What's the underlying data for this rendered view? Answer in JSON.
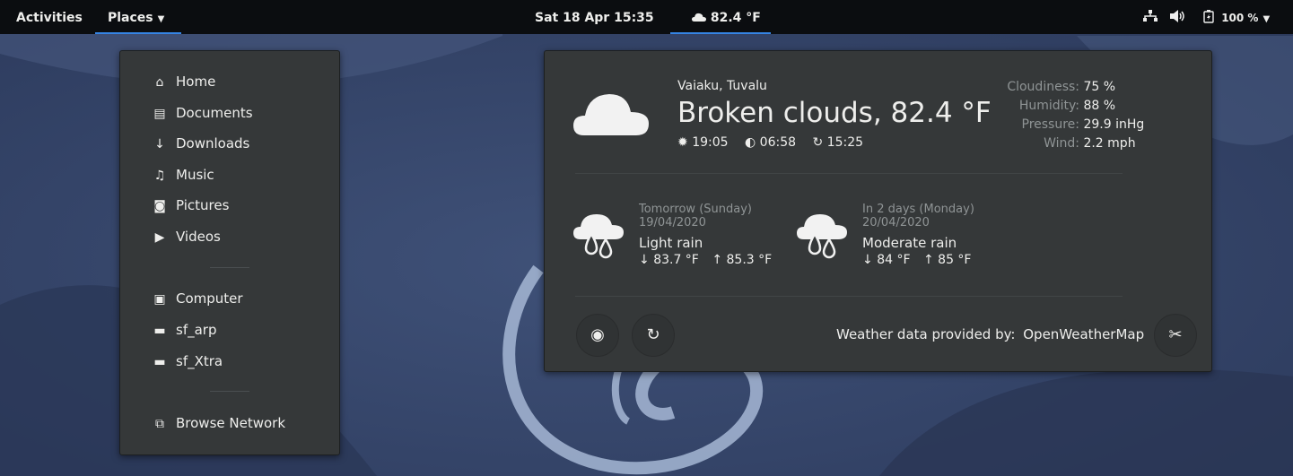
{
  "topbar": {
    "activities_label": "Activities",
    "places_label": "Places",
    "datetime": "Sat 18 Apr 15:35",
    "weather_indicator": "82.4 °F",
    "battery_label": "100 %"
  },
  "places": {
    "items": [
      {
        "label": "Home",
        "icon": "home-icon"
      },
      {
        "label": "Documents",
        "icon": "document-icon"
      },
      {
        "label": "Downloads",
        "icon": "download-icon"
      },
      {
        "label": "Music",
        "icon": "music-icon"
      },
      {
        "label": "Pictures",
        "icon": "camera-icon"
      },
      {
        "label": "Videos",
        "icon": "video-icon"
      }
    ],
    "devices": [
      {
        "label": "Computer",
        "icon": "computer-icon"
      },
      {
        "label": "sf_arp",
        "icon": "drive-icon"
      },
      {
        "label": "sf_Xtra",
        "icon": "drive-icon"
      }
    ],
    "network": {
      "label": "Browse Network",
      "icon": "network-icon"
    }
  },
  "weather": {
    "location": "Vaiaku, Tuvalu",
    "summary": "Broken clouds, 82.4 °F",
    "sunrise": "19:05",
    "sunset": "06:58",
    "updated": "15:25",
    "stats": [
      {
        "label": "Cloudiness:",
        "value": "75 %"
      },
      {
        "label": "Humidity:",
        "value": "88 %"
      },
      {
        "label": "Pressure:",
        "value": "29.9 inHg"
      },
      {
        "label": "Wind:",
        "value": "2.2 mph"
      }
    ],
    "forecast": [
      {
        "day": "Tomorrow (Sunday)",
        "date": "19/04/2020",
        "condition": "Light rain",
        "low": "83.7 °F",
        "high": "85.3 °F"
      },
      {
        "day": "In 2 days (Monday)",
        "date": "20/04/2020",
        "condition": "Moderate rain",
        "low": "84 °F",
        "high": "85 °F"
      }
    ],
    "provider_label": "Weather data provided by:",
    "provider_name": "OpenWeatherMap"
  },
  "colors": {
    "accent": "#3584e4",
    "panel": "#353839",
    "topbar": "#0b0d10"
  }
}
